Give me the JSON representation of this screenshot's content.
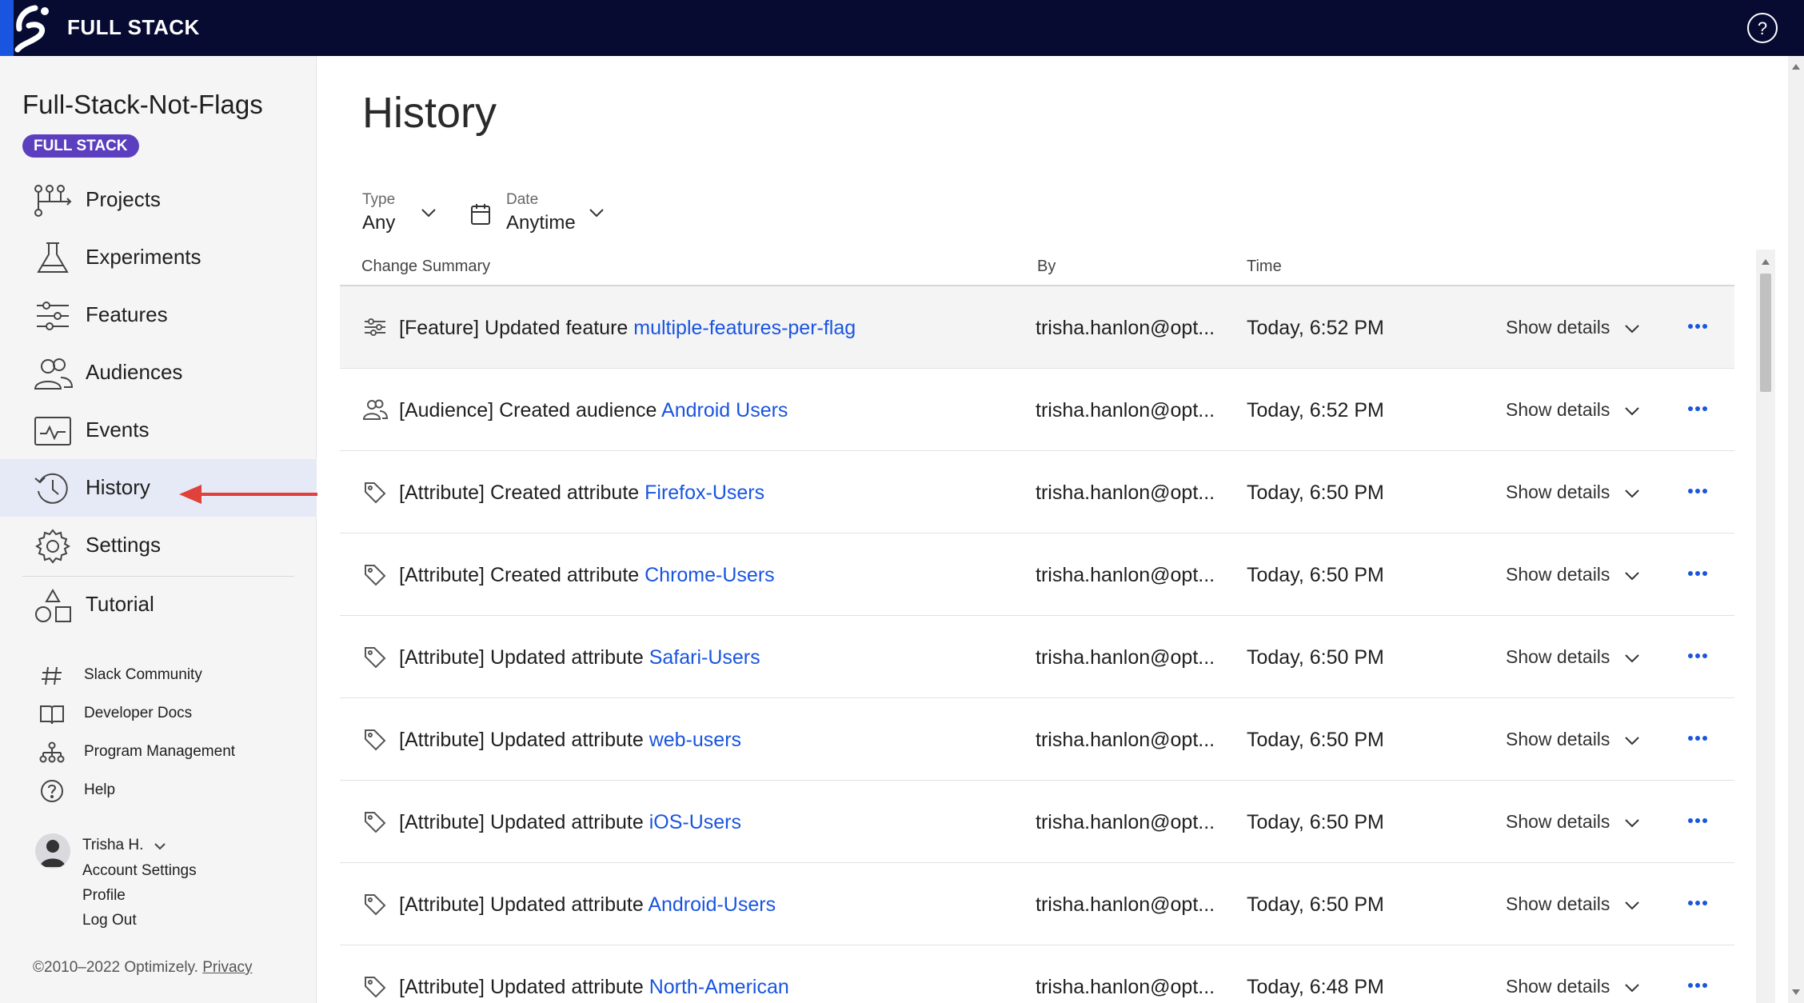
{
  "topbar": {
    "brand": "FULL STACK",
    "logo_icon": "optimizely-logo-icon",
    "help_icon": "help-circle-icon"
  },
  "sidebar": {
    "project_title": "Full-Stack-Not-Flags",
    "project_badge": "FULL STACK",
    "nav": [
      {
        "label": "Projects",
        "icon": "projects-icon"
      },
      {
        "label": "Experiments",
        "icon": "flask-icon"
      },
      {
        "label": "Features",
        "icon": "sliders-icon"
      },
      {
        "label": "Audiences",
        "icon": "users-icon"
      },
      {
        "label": "Events",
        "icon": "pulse-icon"
      },
      {
        "label": "History",
        "icon": "history-icon",
        "active": true
      },
      {
        "label": "Settings",
        "icon": "gear-icon"
      },
      {
        "label": "Tutorial",
        "icon": "shapes-icon"
      }
    ],
    "links": [
      {
        "label": "Slack Community",
        "icon": "hash-icon"
      },
      {
        "label": "Developer Docs",
        "icon": "book-icon"
      },
      {
        "label": "Program Management",
        "icon": "org-chart-icon"
      },
      {
        "label": "Help",
        "icon": "help-circle-icon"
      }
    ],
    "user": {
      "name": "Trisha H.",
      "links": [
        "Account Settings",
        "Profile",
        "Log Out"
      ]
    },
    "copyright": "©2010–2022 Optimizely.",
    "privacy": "Privacy"
  },
  "main": {
    "title": "History",
    "filters": {
      "type": {
        "label": "Type",
        "value": "Any"
      },
      "date": {
        "label": "Date",
        "value": "Anytime"
      }
    },
    "columns": {
      "summary": "Change Summary",
      "by": "By",
      "time": "Time"
    },
    "rows": [
      {
        "icon": "sliders-icon",
        "tag": "[Feature]",
        "action": " Updated feature ",
        "target": "multiple-features-per-flag",
        "by": "trisha.hanlon@opt...",
        "time": "Today, 6:52 PM",
        "details": "Show details"
      },
      {
        "icon": "users-icon",
        "tag": "[Audience]",
        "action": " Created audience ",
        "target": "Android Users",
        "by": "trisha.hanlon@opt...",
        "time": "Today, 6:52 PM",
        "details": "Show details"
      },
      {
        "icon": "tag-icon",
        "tag": "[Attribute]",
        "action": " Created attribute ",
        "target": "Firefox-Users",
        "by": "trisha.hanlon@opt...",
        "time": "Today, 6:50 PM",
        "details": "Show details"
      },
      {
        "icon": "tag-icon",
        "tag": "[Attribute]",
        "action": " Created attribute ",
        "target": "Chrome-Users",
        "by": "trisha.hanlon@opt...",
        "time": "Today, 6:50 PM",
        "details": "Show details"
      },
      {
        "icon": "tag-icon",
        "tag": "[Attribute]",
        "action": " Updated attribute ",
        "target": "Safari-Users",
        "by": "trisha.hanlon@opt...",
        "time": "Today, 6:50 PM",
        "details": "Show details"
      },
      {
        "icon": "tag-icon",
        "tag": "[Attribute]",
        "action": " Updated attribute ",
        "target": "web-users",
        "by": "trisha.hanlon@opt...",
        "time": "Today, 6:50 PM",
        "details": "Show details"
      },
      {
        "icon": "tag-icon",
        "tag": "[Attribute]",
        "action": " Updated attribute ",
        "target": "iOS-Users",
        "by": "trisha.hanlon@opt...",
        "time": "Today, 6:50 PM",
        "details": "Show details"
      },
      {
        "icon": "tag-icon",
        "tag": "[Attribute]",
        "action": " Updated attribute ",
        "target": "Android-Users",
        "by": "trisha.hanlon@opt...",
        "time": "Today, 6:50 PM",
        "details": "Show details"
      },
      {
        "icon": "tag-icon",
        "tag": "[Attribute]",
        "action": " Updated attribute ",
        "target": "North-American",
        "by": "trisha.hanlon@opt...",
        "time": "Today, 6:48 PM",
        "details": "Show details"
      }
    ]
  },
  "colors": {
    "topbar": "#070a31",
    "badge": "#5b3fbf",
    "link": "#1a55e0",
    "active_nav": "#e6e9f6",
    "annotation_arrow": "#e0413a"
  }
}
